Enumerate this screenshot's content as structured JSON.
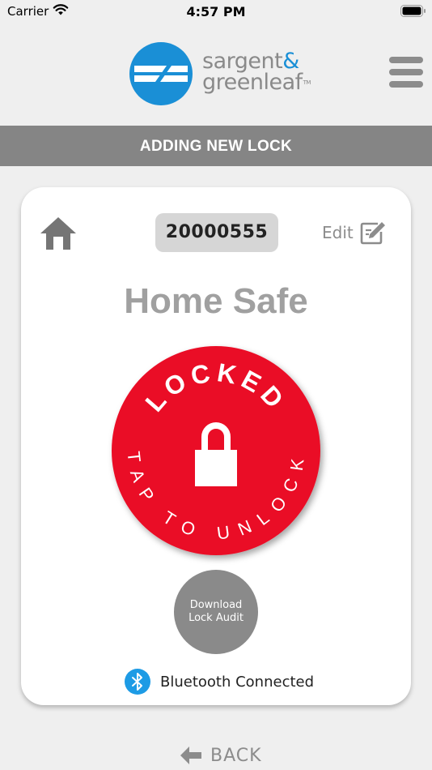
{
  "status_bar": {
    "carrier": "Carrier",
    "time": "4:57 PM"
  },
  "header": {
    "brand_line1": "sargent",
    "brand_amp": "&",
    "brand_line2": "greenleaf",
    "brand_tm": "TM",
    "menu_icon": "hamburger-menu-icon"
  },
  "banner": {
    "title": "ADDING NEW LOCK"
  },
  "card": {
    "home_icon": "home-icon",
    "serial": "20000555",
    "edit_label": "Edit",
    "edit_icon": "edit-icon",
    "lock_name": "Home Safe",
    "lock_status_text": "LOCKED",
    "lock_action_text": "TAP TO UNLOCK",
    "lock_icon": "padlock-icon",
    "download_label": "Download Lock Audit",
    "bluetooth_icon": "bluetooth-icon",
    "bluetooth_status": "Bluetooth Connected"
  },
  "footer": {
    "back_label": "BACK",
    "back_icon": "arrow-left-icon"
  },
  "colors": {
    "lock_red": "#ea0a25",
    "brand_blue": "#1a8fd6",
    "banner_gray": "#858585",
    "bluetooth_blue": "#1d9be5"
  }
}
